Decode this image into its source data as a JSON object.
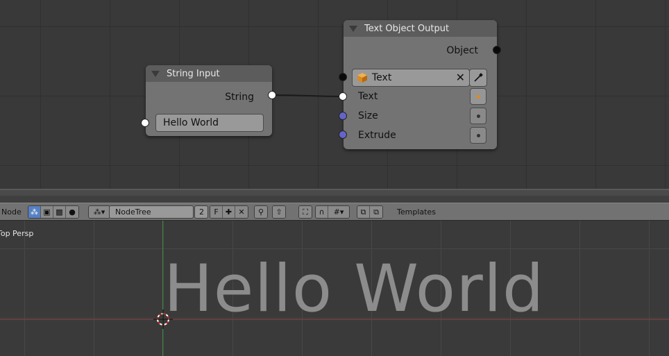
{
  "node_editor": {
    "string_input_node": {
      "title": "String Input",
      "output_label": "String",
      "value": "Hello World"
    },
    "text_output_node": {
      "title": "Text Object Output",
      "output_label": "Object",
      "object_field": "Text",
      "inputs": [
        {
          "label": "Text",
          "socket_color": "#ffffff",
          "toggle_active": true
        },
        {
          "label": "Size",
          "socket_color": "#6464c8",
          "toggle_active": false
        },
        {
          "label": "Extrude",
          "socket_color": "#6464c8",
          "toggle_active": false
        }
      ]
    }
  },
  "header": {
    "editor_label": "Node",
    "node_tree_name": "NodeTree",
    "users_count": "2",
    "fake_user": "F",
    "templates_label": "Templates"
  },
  "viewport": {
    "view_label": "Top Persp",
    "text_object": "Hello World"
  },
  "colors": {
    "accent_blue": "#5680c2",
    "active_orange": "#e08a1e",
    "vector_socket": "#6464c8"
  }
}
